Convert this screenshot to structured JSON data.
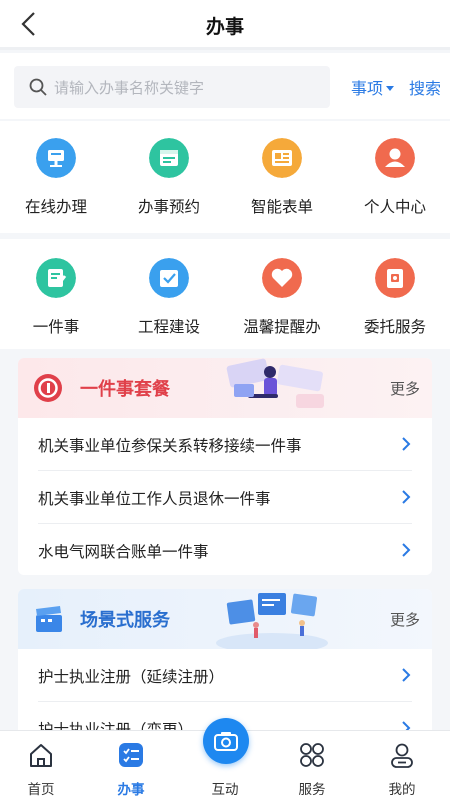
{
  "header": {
    "title": "办事"
  },
  "search": {
    "placeholder": "请输入办事名称关键字",
    "filter_label": "事项",
    "search_label": "搜索"
  },
  "services_row1": [
    {
      "label": "在线办理",
      "icon": "online-handle-icon",
      "color": "#3aa0ee"
    },
    {
      "label": "办事预约",
      "icon": "appointment-icon",
      "color": "#2ec4a0"
    },
    {
      "label": "智能表单",
      "icon": "smart-form-icon",
      "color": "#f5a93a"
    },
    {
      "label": "个人中心",
      "icon": "person-icon",
      "color": "#f06a4e"
    }
  ],
  "services_row2": [
    {
      "label": "一件事",
      "icon": "one-thing-icon",
      "color": "#2ec4a0"
    },
    {
      "label": "工程建设",
      "icon": "construction-icon",
      "color": "#3aa0ee"
    },
    {
      "label": "温馨提醒办",
      "icon": "heart-icon",
      "color": "#f06a4e"
    },
    {
      "label": "委托服务",
      "icon": "delegate-icon",
      "color": "#f06a4e"
    }
  ],
  "package": {
    "title": "一件事套餐",
    "more": "更多",
    "items": [
      "机关事业单位参保关系转移接续一件事",
      "机关事业单位工作人员退休一件事",
      "水电气网联合账单一件事"
    ]
  },
  "scene": {
    "title": "场景式服务",
    "more": "更多",
    "items": [
      "护士执业注册（延续注册）",
      "护士执业注册（变更）"
    ]
  },
  "tabbar": {
    "tabs": [
      {
        "label": "首页",
        "icon": "home-icon"
      },
      {
        "label": "办事",
        "icon": "tasks-icon"
      },
      {
        "label": "互动",
        "icon": "camera-icon"
      },
      {
        "label": "服务",
        "icon": "services-grid-icon"
      },
      {
        "label": "我的",
        "icon": "profile-icon"
      }
    ],
    "active": "办事"
  },
  "colors": {
    "accent": "#2a7ae4",
    "package_title": "#e0404a",
    "scene_title": "#2a6fcf"
  }
}
